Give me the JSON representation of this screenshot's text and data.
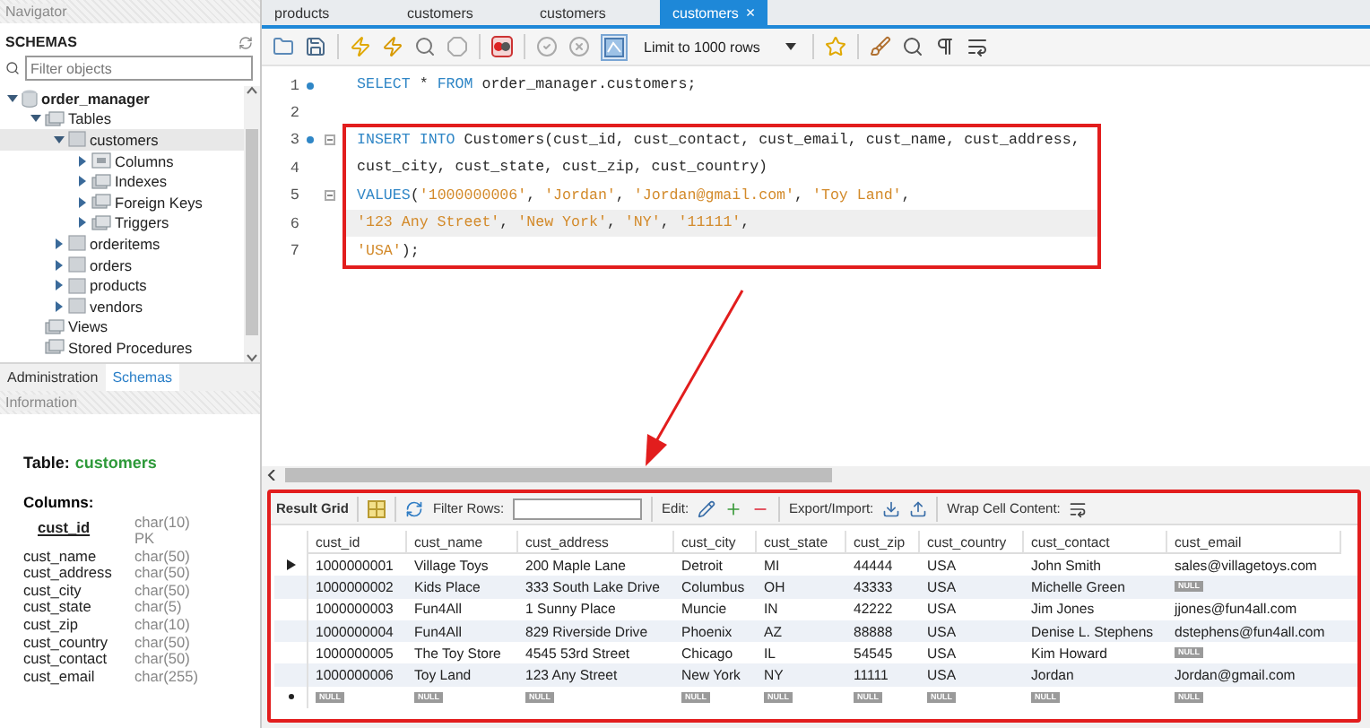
{
  "navigator": {
    "title": "Navigator",
    "schemas_label": "SCHEMAS",
    "filter": {
      "placeholder": "Filter objects"
    },
    "tree": [
      {
        "label": "order_manager",
        "kind": "schema",
        "expanded": true,
        "selected": false,
        "children": [
          {
            "label": "Tables",
            "kind": "folder",
            "expanded": true,
            "selected": false,
            "children": [
              {
                "label": "customers",
                "kind": "table",
                "expanded": true,
                "selected": true,
                "children": [
                  {
                    "label": "Columns",
                    "kind": "columns",
                    "expanded": false,
                    "selected": false
                  },
                  {
                    "label": "Indexes",
                    "kind": "folder",
                    "expanded": false,
                    "selected": false
                  },
                  {
                    "label": "Foreign Keys",
                    "kind": "folder",
                    "expanded": false,
                    "selected": false
                  },
                  {
                    "label": "Triggers",
                    "kind": "folder",
                    "expanded": false,
                    "selected": false
                  }
                ]
              },
              {
                "label": "orderitems",
                "kind": "table",
                "expanded": false,
                "selected": false
              },
              {
                "label": "orders",
                "kind": "table",
                "expanded": false,
                "selected": false
              },
              {
                "label": "products",
                "kind": "table",
                "expanded": false,
                "selected": false
              },
              {
                "label": "vendors",
                "kind": "table",
                "expanded": false,
                "selected": false
              }
            ]
          },
          {
            "label": "Views",
            "kind": "folder",
            "selected": false
          },
          {
            "label": "Stored Procedures",
            "kind": "folder",
            "selected": false
          }
        ]
      }
    ],
    "tabs": [
      {
        "label": "Administration",
        "selected": false
      },
      {
        "label": "Schemas",
        "selected": true
      }
    ]
  },
  "information": {
    "title": "Information",
    "table_label": "Table:",
    "table_name": "customers",
    "columns_label": "Columns:",
    "columns": [
      {
        "name": "cust_id",
        "type": "char(10)",
        "kind": "pk",
        "key_label": "PK"
      },
      {
        "name": "cust_name",
        "type": "char(50)",
        "kind": "plain"
      },
      {
        "name": "cust_address",
        "type": "char(50)",
        "kind": "plain"
      },
      {
        "name": "cust_city",
        "type": "char(50)",
        "kind": "plain"
      },
      {
        "name": "cust_state",
        "type": "char(5)",
        "kind": "plain"
      },
      {
        "name": "cust_zip",
        "type": "char(10)",
        "kind": "plain"
      },
      {
        "name": "cust_country",
        "type": "char(50)",
        "kind": "plain"
      },
      {
        "name": "cust_contact",
        "type": "char(50)",
        "kind": "plain"
      },
      {
        "name": "cust_email",
        "type": "char(255)",
        "kind": "plain"
      }
    ]
  },
  "editor_tabs": [
    {
      "label": "products",
      "selected": false
    },
    {
      "label": "customers",
      "selected": false
    },
    {
      "label": "customers",
      "selected": false
    },
    {
      "label": "customers",
      "selected": true,
      "close": "×"
    }
  ],
  "toolbar": {
    "limit": "Limit to 1000 rows"
  },
  "editor": {
    "lines": [
      {
        "number": "1",
        "dot": true,
        "fold": false,
        "current": false,
        "boxed": false,
        "tokens": [
          {
            "kind": "keyword",
            "text": "SELECT"
          },
          {
            "kind": "plain",
            "text": " * "
          },
          {
            "kind": "keyword",
            "text": "FROM"
          },
          {
            "kind": "plain",
            "text": " order_manager.customers;"
          }
        ]
      },
      {
        "number": "2",
        "dot": false,
        "fold": false,
        "current": false,
        "boxed": false
      },
      {
        "number": "3",
        "dot": true,
        "fold": true,
        "current": false,
        "boxed": true,
        "tokens": [
          {
            "kind": "keyword",
            "text": "INSERT INTO"
          },
          {
            "kind": "plain",
            "text": " Customers(cust_id, cust_contact, cust_email, cust_name, cust_address,"
          }
        ]
      },
      {
        "number": "4",
        "dot": false,
        "fold": false,
        "current": false,
        "boxed": true,
        "tokens": [
          {
            "kind": "plain",
            "text": "cust_city, cust_state, cust_zip, cust_country)"
          }
        ]
      },
      {
        "number": "5",
        "dot": false,
        "fold": true,
        "current": false,
        "boxed": true,
        "tokens": [
          {
            "kind": "keyword",
            "text": "VALUES"
          },
          {
            "kind": "plain",
            "text": "("
          },
          {
            "kind": "string",
            "text": "'1000000006'"
          },
          {
            "kind": "plain",
            "text": ", "
          },
          {
            "kind": "string",
            "text": "'Jordan'"
          },
          {
            "kind": "plain",
            "text": ", "
          },
          {
            "kind": "string",
            "text": "'Jordan@gmail.com'"
          },
          {
            "kind": "plain",
            "text": ", "
          },
          {
            "kind": "string",
            "text": "'Toy Land'"
          },
          {
            "kind": "plain",
            "text": ","
          }
        ]
      },
      {
        "number": "6",
        "dot": false,
        "fold": false,
        "current": true,
        "boxed": true,
        "tokens": [
          {
            "kind": "string",
            "text": "'123 Any Street'"
          },
          {
            "kind": "plain",
            "text": ", "
          },
          {
            "kind": "string",
            "text": "'New York'"
          },
          {
            "kind": "plain",
            "text": ", "
          },
          {
            "kind": "string",
            "text": "'NY'"
          },
          {
            "kind": "plain",
            "text": ", "
          },
          {
            "kind": "string",
            "text": "'11111'"
          },
          {
            "kind": "plain",
            "text": ","
          }
        ]
      },
      {
        "number": "7",
        "dot": false,
        "fold": false,
        "current": false,
        "boxed": true,
        "tokens": [
          {
            "kind": "string",
            "text": "'USA'"
          },
          {
            "kind": "plain",
            "text": ");"
          }
        ]
      }
    ]
  },
  "result": {
    "tabs": {
      "grid_label": "Result Grid",
      "filter_label": "Filter Rows:",
      "edit_label": "Edit:",
      "export_label": "Export/Import:",
      "wrap_label": "Wrap Cell Content:"
    },
    "columns": [
      "cust_id",
      "cust_name",
      "cust_address",
      "cust_city",
      "cust_state",
      "cust_zip",
      "cust_country",
      "cust_contact",
      "cust_email"
    ],
    "rows": [
      {
        "current": true,
        "cells": [
          "1000000001",
          "Village Toys",
          "200 Maple Lane",
          "Detroit",
          "MI",
          "44444",
          "USA",
          "John Smith",
          "sales@villagetoys.com"
        ]
      },
      {
        "current": false,
        "cells": [
          "1000000002",
          "Kids Place",
          "333 South Lake Drive",
          "Columbus",
          "OH",
          "43333",
          "USA",
          "Michelle Green",
          {
            "null": "NULL"
          }
        ]
      },
      {
        "current": false,
        "cells": [
          "1000000003",
          "Fun4All",
          "1 Sunny Place",
          "Muncie",
          "IN",
          "42222",
          "USA",
          "Jim Jones",
          "jjones@fun4all.com"
        ]
      },
      {
        "current": false,
        "cells": [
          "1000000004",
          "Fun4All",
          "829 Riverside Drive",
          "Phoenix",
          "AZ",
          "88888",
          "USA",
          "Denise L. Stephens",
          "dstephens@fun4all.com"
        ]
      },
      {
        "current": false,
        "cells": [
          "1000000005",
          "The Toy Store",
          "4545 53rd Street",
          "Chicago",
          "IL",
          "54545",
          "USA",
          "Kim Howard",
          {
            "null": "NULL"
          }
        ]
      },
      {
        "current": false,
        "cells": [
          "1000000006",
          "Toy Land",
          "123 Any Street",
          "New York",
          "NY",
          "11111",
          "USA",
          "Jordan",
          "Jordan@gmail.com"
        ]
      },
      {
        "current": false,
        "new_row": true,
        "cells": [
          {
            "null": "NULL"
          },
          {
            "null": "NULL"
          },
          {
            "null": "NULL"
          },
          {
            "null": "NULL"
          },
          {
            "null": "NULL"
          },
          {
            "null": "NULL"
          },
          {
            "null": "NULL"
          },
          {
            "null": "NULL"
          },
          {
            "null": "NULL"
          }
        ]
      }
    ]
  }
}
